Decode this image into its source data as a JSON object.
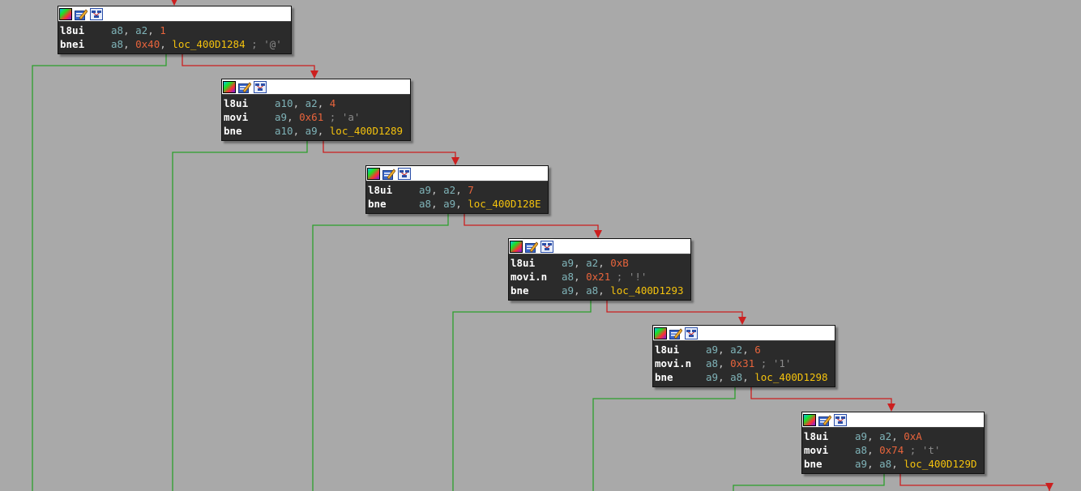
{
  "colors": {
    "background": "#a9a9a9",
    "node_bg": "#2b2b2b",
    "true_edge": "#2ca02c",
    "false_edge": "#cc1f1f"
  },
  "header_icons": [
    "color-palette-icon",
    "edit-node-icon",
    "graph-overview-icon"
  ],
  "nodes": [
    {
      "lines": [
        {
          "mnemonic": "l8ui",
          "ops": [
            {
              "t": "reg",
              "v": "a8"
            },
            {
              "t": "reg",
              "v": "a2"
            },
            {
              "t": "imm",
              "v": "1"
            }
          ]
        },
        {
          "mnemonic": "bnei",
          "ops": [
            {
              "t": "reg",
              "v": "a8"
            },
            {
              "t": "imm",
              "v": "0x40"
            },
            {
              "t": "loc",
              "v": "loc_400D1284"
            }
          ],
          "comment": "; '@'"
        }
      ]
    },
    {
      "lines": [
        {
          "mnemonic": "l8ui",
          "ops": [
            {
              "t": "reg",
              "v": "a10"
            },
            {
              "t": "reg",
              "v": "a2"
            },
            {
              "t": "imm",
              "v": "4"
            }
          ]
        },
        {
          "mnemonic": "movi",
          "ops": [
            {
              "t": "reg",
              "v": "a9"
            },
            {
              "t": "imm",
              "v": "0x61"
            }
          ],
          "comment": "; 'a'"
        },
        {
          "mnemonic": "bne",
          "ops": [
            {
              "t": "reg",
              "v": "a10"
            },
            {
              "t": "reg",
              "v": "a9"
            },
            {
              "t": "loc",
              "v": "loc_400D1289"
            }
          ]
        }
      ]
    },
    {
      "lines": [
        {
          "mnemonic": "l8ui",
          "ops": [
            {
              "t": "reg",
              "v": "a9"
            },
            {
              "t": "reg",
              "v": "a2"
            },
            {
              "t": "imm",
              "v": "7"
            }
          ]
        },
        {
          "mnemonic": "bne",
          "ops": [
            {
              "t": "reg",
              "v": "a8"
            },
            {
              "t": "reg",
              "v": "a9"
            },
            {
              "t": "loc",
              "v": "loc_400D128E"
            }
          ]
        }
      ]
    },
    {
      "lines": [
        {
          "mnemonic": "l8ui",
          "ops": [
            {
              "t": "reg",
              "v": "a9"
            },
            {
              "t": "reg",
              "v": "a2"
            },
            {
              "t": "imm",
              "v": "0xB"
            }
          ]
        },
        {
          "mnemonic": "movi.n",
          "ops": [
            {
              "t": "reg",
              "v": "a8"
            },
            {
              "t": "imm",
              "v": "0x21"
            }
          ],
          "comment": "; '!'"
        },
        {
          "mnemonic": "bne",
          "ops": [
            {
              "t": "reg",
              "v": "a9"
            },
            {
              "t": "reg",
              "v": "a8"
            },
            {
              "t": "loc",
              "v": "loc_400D1293"
            }
          ]
        }
      ]
    },
    {
      "lines": [
        {
          "mnemonic": "l8ui",
          "ops": [
            {
              "t": "reg",
              "v": "a9"
            },
            {
              "t": "reg",
              "v": "a2"
            },
            {
              "t": "imm",
              "v": "6"
            }
          ]
        },
        {
          "mnemonic": "movi.n",
          "ops": [
            {
              "t": "reg",
              "v": "a8"
            },
            {
              "t": "imm",
              "v": "0x31"
            }
          ],
          "comment": "; '1'"
        },
        {
          "mnemonic": "bne",
          "ops": [
            {
              "t": "reg",
              "v": "a9"
            },
            {
              "t": "reg",
              "v": "a8"
            },
            {
              "t": "loc",
              "v": "loc_400D1298"
            }
          ]
        }
      ]
    },
    {
      "lines": [
        {
          "mnemonic": "l8ui",
          "ops": [
            {
              "t": "reg",
              "v": "a9"
            },
            {
              "t": "reg",
              "v": "a2"
            },
            {
              "t": "imm",
              "v": "0xA"
            }
          ]
        },
        {
          "mnemonic": "movi",
          "ops": [
            {
              "t": "reg",
              "v": "a8"
            },
            {
              "t": "imm",
              "v": "0x74"
            }
          ],
          "comment": "; 't'"
        },
        {
          "mnemonic": "bne",
          "ops": [
            {
              "t": "reg",
              "v": "a9"
            },
            {
              "t": "reg",
              "v": "a8"
            },
            {
              "t": "loc",
              "v": "loc_400D129D"
            }
          ]
        }
      ]
    }
  ]
}
